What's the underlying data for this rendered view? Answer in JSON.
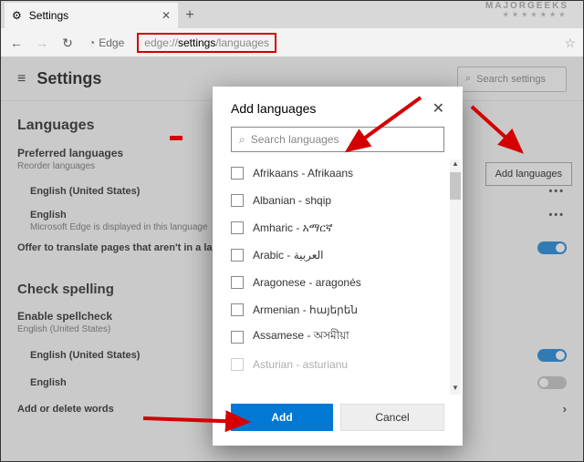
{
  "watermark": {
    "text": "MAJORGEEKS",
    "stars": "★★★★★★★"
  },
  "browser": {
    "tab_title": "Settings",
    "edge_label": "Edge",
    "url_prefix": "edge://",
    "url_mid": "settings",
    "url_suffix": "/languages"
  },
  "settings": {
    "title": "Settings",
    "search_placeholder": "Search settings",
    "section_languages": "Languages",
    "preferred_heading": "Preferred languages",
    "reorder_hint": "Reorder languages",
    "add_languages_btn": "Add languages",
    "lang1": "English (United States)",
    "lang2": "English",
    "lang2_sub": "Microsoft Edge is displayed in this language",
    "offer_translate": "Offer to translate pages that aren't in a la",
    "section_check": "Check spelling",
    "enable_spell": "Enable spellcheck",
    "enable_spell_sub": "English (United States)",
    "spell1": "English (United States)",
    "spell2": "English",
    "add_delete": "Add or delete words"
  },
  "dialog": {
    "title": "Add languages",
    "search_placeholder": "Search languages",
    "items": [
      "Afrikaans - Afrikaans",
      "Albanian - shqip",
      "Amharic - አማርኛ",
      "Arabic - العربية",
      "Aragonese - aragonés",
      "Armenian - հայերեն",
      "Assamese - অসমীয়া",
      "Asturian - asturianu"
    ],
    "add": "Add",
    "cancel": "Cancel"
  }
}
